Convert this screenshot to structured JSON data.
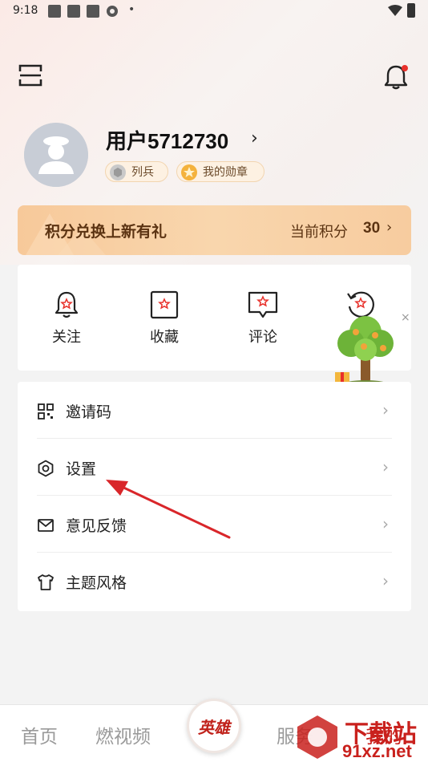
{
  "status_bar": {
    "time": "9:18",
    "dot": "•"
  },
  "profile": {
    "username": "用户5712730",
    "chevron": "›",
    "rank_badge": "列兵",
    "medal_badge": "我的勋章"
  },
  "points": {
    "title": "积分兑换上新有礼",
    "label": "当前积分",
    "value": "30",
    "chevron": "›"
  },
  "actions": [
    {
      "label": "关注",
      "icon": "bell-star-icon"
    },
    {
      "label": "收藏",
      "icon": "bookmark-star-icon"
    },
    {
      "label": "评论",
      "icon": "comment-star-icon"
    },
    {
      "label": "",
      "icon": "history-star-icon"
    }
  ],
  "floating_widget": {
    "close": "×"
  },
  "menu": [
    {
      "label": "邀请码",
      "icon": "qr-code-icon"
    },
    {
      "label": "设置",
      "icon": "hexagon-settings-icon"
    },
    {
      "label": "意见反馈",
      "icon": "mail-icon"
    },
    {
      "label": "主题风格",
      "icon": "shirt-icon"
    }
  ],
  "menu_chevron": "›",
  "bottom_nav": {
    "home": "首页",
    "video": "燃视频",
    "center": "英雄",
    "service": "服务",
    "mine": "我的"
  },
  "watermark": {
    "line1": "下载站",
    "line2": "91xz.net"
  },
  "colors": {
    "accent_red": "#e8302a",
    "points_banner": "#f8cfa3",
    "points_text": "#5b3312",
    "annotation_arrow": "#d9262a"
  }
}
